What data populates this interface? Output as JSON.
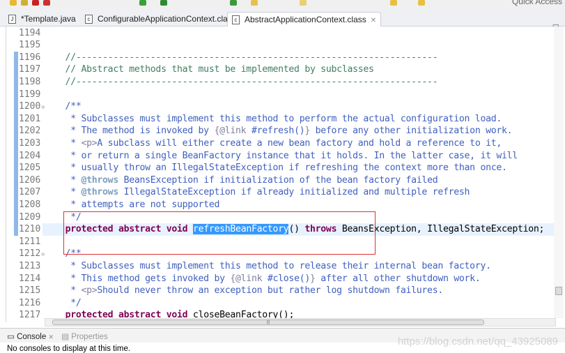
{
  "toolbar": {
    "quick_access": "Quick Access"
  },
  "tabs": [
    {
      "label": "*Template.java",
      "icon": "java-file-icon",
      "active": false
    },
    {
      "label": "ConfigurableApplicationContext.class",
      "icon": "class-file-icon",
      "active": false
    },
    {
      "label": "AbstractApplicationContext.class",
      "icon": "class-file-icon",
      "active": true
    }
  ],
  "editor": {
    "selected_text": "refreshBeanFactory",
    "current_line": "1210",
    "lines": [
      {
        "n": "1194",
        "s": []
      },
      {
        "n": "1195",
        "s": []
      },
      {
        "n": "1196",
        "s": [
          [
            "c",
            "    //--------------------------------------------------------------------"
          ]
        ]
      },
      {
        "n": "1197",
        "s": [
          [
            "c",
            "    // Abstract methods that must be implemented by subclasses"
          ]
        ]
      },
      {
        "n": "1198",
        "s": [
          [
            "c",
            "    //--------------------------------------------------------------------"
          ]
        ]
      },
      {
        "n": "1199",
        "s": []
      },
      {
        "n": "1200",
        "fold": true,
        "s": [
          [
            "d",
            "    /**"
          ]
        ]
      },
      {
        "n": "1201",
        "s": [
          [
            "d",
            "     * Subclasses must implement this method to perform the actual configuration load."
          ]
        ]
      },
      {
        "n": "1202",
        "s": [
          [
            "d",
            "     * The method is invoked by "
          ],
          [
            "h",
            "{@link"
          ],
          [
            "d",
            " #refresh()"
          ],
          [
            "h",
            "}"
          ],
          [
            "d",
            " before any other initialization work."
          ]
        ]
      },
      {
        "n": "1203",
        "s": [
          [
            "d",
            "     * "
          ],
          [
            "h",
            "<p>"
          ],
          [
            "d",
            "A subclass will either create a new bean factory and hold a reference to it,"
          ]
        ]
      },
      {
        "n": "1204",
        "s": [
          [
            "d",
            "     * or return a single BeanFactory instance that it holds. In the latter case, it will"
          ]
        ]
      },
      {
        "n": "1205",
        "s": [
          [
            "d",
            "     * usually throw an IllegalStateException if refreshing the context more than once."
          ]
        ]
      },
      {
        "n": "1206",
        "s": [
          [
            "d",
            "     * "
          ],
          [
            "t",
            "@throws"
          ],
          [
            "d",
            " BeansException if initialization of the bean factory failed"
          ]
        ]
      },
      {
        "n": "1207",
        "s": [
          [
            "d",
            "     * "
          ],
          [
            "t",
            "@throws"
          ],
          [
            "d",
            " IllegalStateException if already initialized and multiple refresh"
          ]
        ]
      },
      {
        "n": "1208",
        "s": [
          [
            "d",
            "     * attempts are not supported"
          ]
        ]
      },
      {
        "n": "1209",
        "s": [
          [
            "d",
            "     */"
          ]
        ]
      },
      {
        "n": "1210",
        "s": [
          [
            "n",
            "    "
          ],
          [
            "k",
            "protected"
          ],
          [
            "n",
            " "
          ],
          [
            "k",
            "abstract"
          ],
          [
            "n",
            " "
          ],
          [
            "k",
            "void"
          ],
          [
            "n",
            " "
          ],
          [
            "sel",
            "refreshBeanFactory"
          ],
          [
            "n",
            "() "
          ],
          [
            "k",
            "throws"
          ],
          [
            "n",
            " BeansException, IllegalStateException;"
          ]
        ]
      },
      {
        "n": "1211",
        "s": []
      },
      {
        "n": "1212",
        "fold": true,
        "s": [
          [
            "d",
            "    /**"
          ]
        ]
      },
      {
        "n": "1213",
        "s": [
          [
            "d",
            "     * Subclasses must implement this method to release their internal bean factory."
          ]
        ]
      },
      {
        "n": "1214",
        "s": [
          [
            "d",
            "     * This method gets invoked by "
          ],
          [
            "h",
            "{@link"
          ],
          [
            "d",
            " #close()"
          ],
          [
            "h",
            "}"
          ],
          [
            "d",
            " after all other shutdown work."
          ]
        ]
      },
      {
        "n": "1215",
        "s": [
          [
            "d",
            "     * "
          ],
          [
            "h",
            "<p>"
          ],
          [
            "d",
            "Should never throw an exception but rather log shutdown failures."
          ]
        ]
      },
      {
        "n": "1216",
        "s": [
          [
            "d",
            "     */"
          ]
        ]
      },
      {
        "n": "1217",
        "s": [
          [
            "n",
            "    "
          ],
          [
            "k",
            "protected"
          ],
          [
            "n",
            " "
          ],
          [
            "k",
            "abstract"
          ],
          [
            "n",
            " "
          ],
          [
            "k",
            "void"
          ],
          [
            "n",
            " closeBeanFactory();"
          ]
        ]
      }
    ]
  },
  "console": {
    "tab_console": "Console",
    "tab_properties": "Properties",
    "message": "No consoles to display at this time.",
    "watermark": "https://blog.csdn.net/qq_43925089"
  },
  "colors": {
    "keyword": "#7f0055",
    "comment": "#3f7f5f",
    "javadoc": "#3f5fbf",
    "selection": "#3399ff",
    "annotation_box": "#e03030"
  }
}
